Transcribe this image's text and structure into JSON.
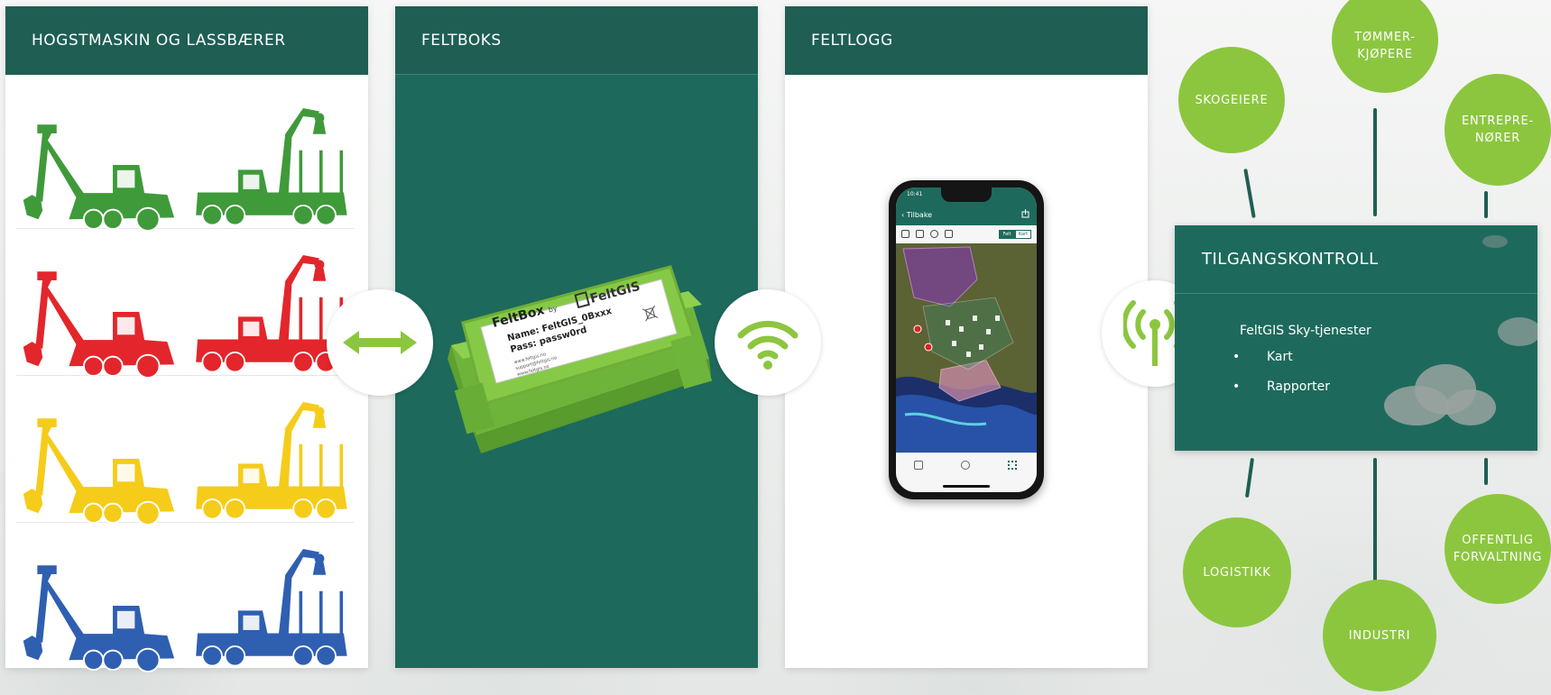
{
  "panels": {
    "machines": {
      "title": "HOGSTMASKIN OG LASSBÆRER"
    },
    "feltboks": {
      "title": "FELTBOKS"
    },
    "feltlogg": {
      "title": "FELTLOGG"
    }
  },
  "machine_colors": [
    "#3f9a3a",
    "#e3262b",
    "#f5cc1a",
    "#2f5fb1"
  ],
  "connectors": {
    "bidirectional": "double-arrow-icon",
    "wireless": "wifi-icon",
    "antenna": "antenna-icon"
  },
  "feltbox_device": {
    "brand": "FeltBox",
    "by": "by",
    "maker": "FeltGIS",
    "name_line": "Name: FeltGIS_0Bxxx",
    "pass_line": "Pass: passw0rd",
    "small_lines": [
      "www.feltgis.no",
      "support@feltgis.no",
      "www.feltgis.no"
    ]
  },
  "phone": {
    "time": "10:41",
    "back_label": "Tilbake",
    "toggle_a": "Felt",
    "toggle_b": "Kart"
  },
  "access": {
    "title": "TILGANGSKONTROLL",
    "service": "FeltGIS Sky-tjenester",
    "items": [
      "Kart",
      "Rapporter"
    ]
  },
  "actors": {
    "skogeiere": "SKOGEIERE",
    "tommer_1": "TØMMER-",
    "tommer_2": "KJØPERE",
    "entre_1": "ENTREPRE-",
    "entre_2": "NØRER",
    "logistikk": "LOGISTIKK",
    "industri": "INDUSTRI",
    "offentlig_1": "OFFENTLIG",
    "offentlig_2": "FORVALTNING"
  },
  "colors": {
    "dark_green": "#1f5e53",
    "panel_green": "#1d6a5c",
    "lime": "#8cc63f"
  }
}
